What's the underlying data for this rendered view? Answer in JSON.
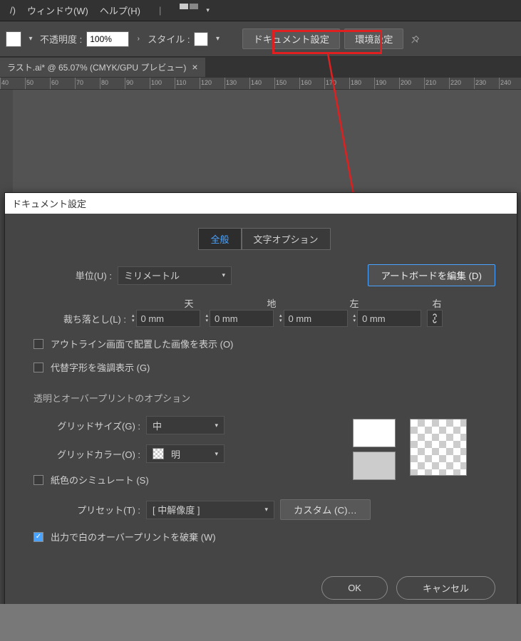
{
  "menubar": {
    "items": [
      "/)",
      "ウィンドウ(W)",
      "ヘルプ(H)"
    ]
  },
  "optionbar": {
    "opacity_label": "不透明度 :",
    "opacity_value": "100%",
    "style_label": "スタイル :",
    "doc_settings": "ドキュメント設定",
    "prefs": "環境設定"
  },
  "tab": {
    "title": "ラスト.ai* @ 65.07% (CMYK/GPU プレビュー)"
  },
  "ruler": [
    40,
    50,
    60,
    70,
    80,
    90,
    100,
    110,
    120,
    130,
    140,
    150,
    160,
    170,
    180,
    190,
    200,
    210,
    220,
    230,
    240
  ],
  "dialog": {
    "title": "ドキュメント設定",
    "tabs": {
      "general": "全般",
      "text": "文字オプション"
    },
    "units_label": "単位(U) :",
    "units_value": "ミリメートル",
    "edit_artboard": "アートボードを編集 (D)",
    "bleed": {
      "label": "裁ち落とし(L) :",
      "headers": [
        "天",
        "地",
        "左",
        "右"
      ],
      "values": [
        "0 mm",
        "0 mm",
        "0 mm",
        "0 mm"
      ]
    },
    "cb_outline": "アウトライン画面で配置した画像を表示 (O)",
    "cb_altglyph": "代替字形を強調表示 (G)",
    "section_transp": "透明とオーバープリントのオプション",
    "gridsize_label": "グリッドサイズ(G) :",
    "gridsize_value": "中",
    "gridcolor_label": "グリッドカラー(O) :",
    "gridcolor_value": "明",
    "cb_simpaper": "紙色のシミュレート (S)",
    "preset_label": "プリセット(T) :",
    "preset_value": "[ 中解像度 ]",
    "custom_btn": "カスタム (C)…",
    "cb_discard": "出力で白のオーバープリントを破棄 (W)",
    "ok": "OK",
    "cancel": "キャンセル"
  }
}
